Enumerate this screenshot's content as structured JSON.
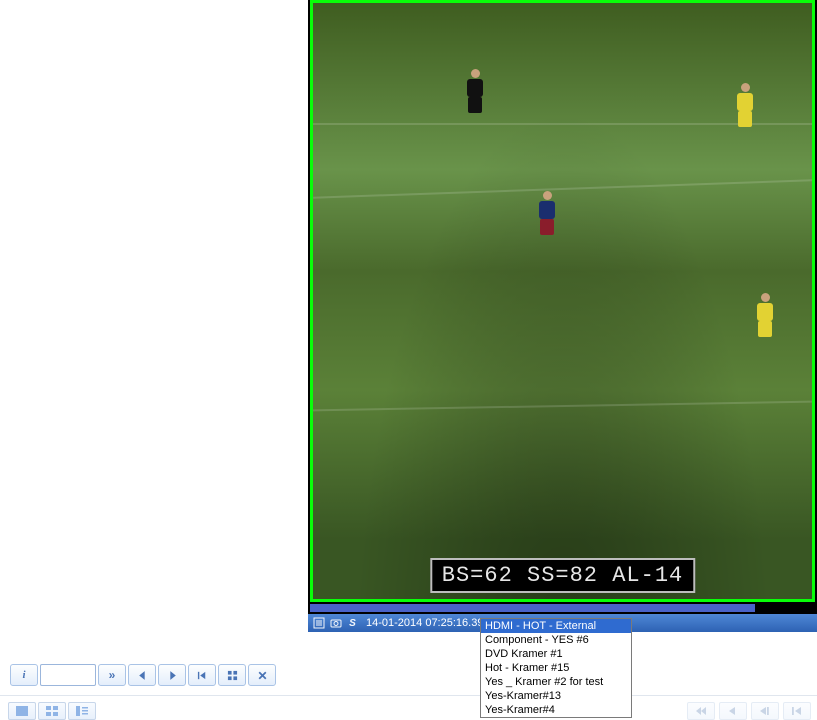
{
  "video": {
    "osd_text": "BS=62 SS=82 AL-14"
  },
  "status": {
    "timestamp": "14-01-2014 07:25:16.39"
  },
  "source_menu": {
    "items": [
      "HDMI - HOT - External",
      "Component - YES #6",
      "DVD Kramer #1",
      "Hot - Kramer #15",
      "Yes _ Kramer #2 for test",
      "Yes-Kramer#13",
      "Yes-Kramer#4"
    ],
    "selected_index": 0
  },
  "toolbar": {
    "goto_value": ""
  },
  "colors": {
    "accent": "#2f6bd0",
    "frame": "#08ff08"
  }
}
